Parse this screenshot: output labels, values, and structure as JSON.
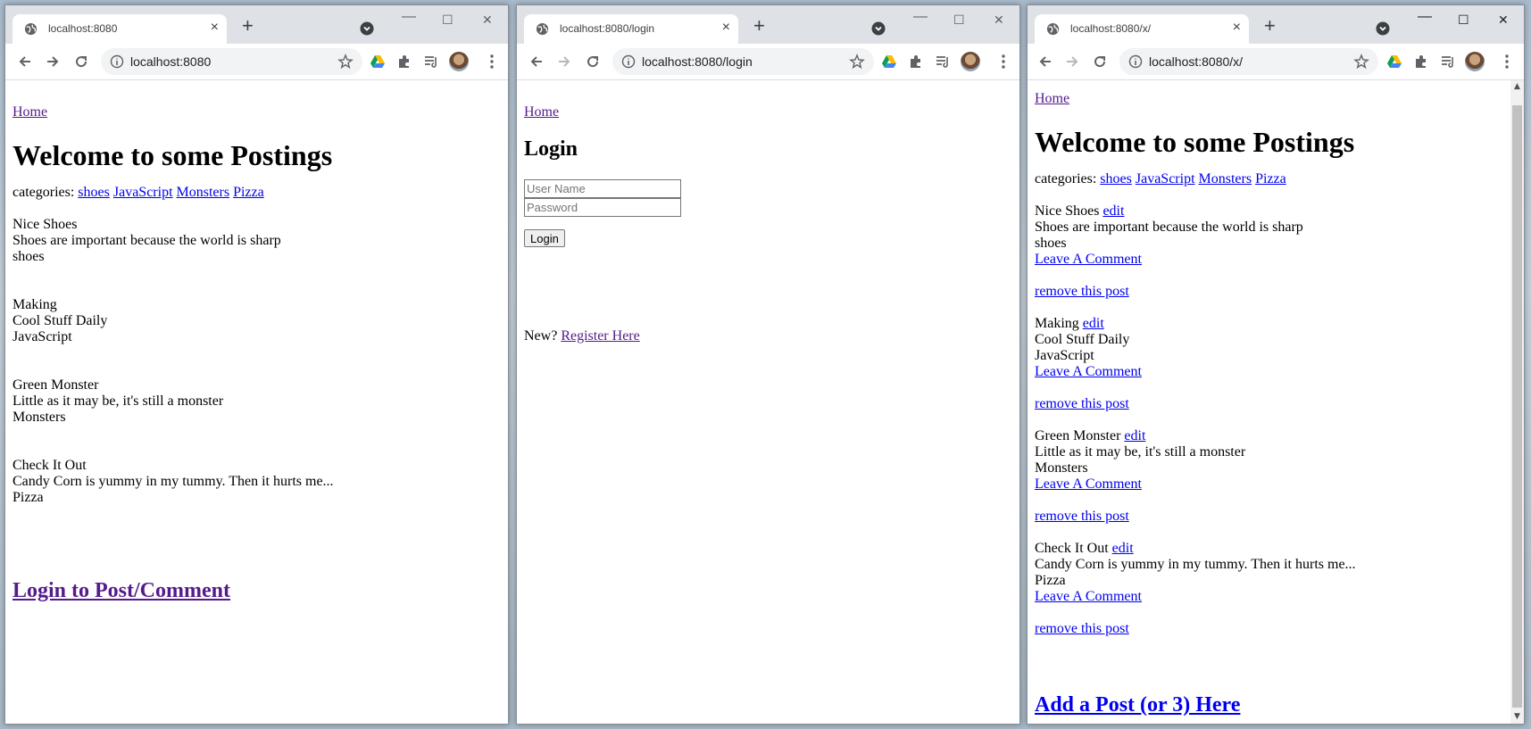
{
  "windows": [
    {
      "tab_title": "localhost:8080",
      "url": "localhost:8080",
      "home_link": "Home",
      "heading": "Welcome to some Postings",
      "categories_label": "categories:",
      "categories": [
        "shoes",
        "JavaScript",
        "Monsters",
        "Pizza"
      ],
      "posts": [
        {
          "title": "Nice Shoes",
          "body": "Shoes are important because the world is sharp",
          "category": "shoes"
        },
        {
          "title": "Making",
          "body": "Cool Stuff Daily",
          "category": "JavaScript"
        },
        {
          "title": "Green Monster",
          "body": "Little as it may be, it's still a monster",
          "category": "Monsters"
        },
        {
          "title": "Check It Out",
          "body": "Candy Corn is yummy in my tummy. Then it hurts me...",
          "category": "Pizza"
        }
      ],
      "footer_link": "Login to Post/Comment"
    },
    {
      "tab_title": "localhost:8080/login",
      "url": "localhost:8080/login",
      "home_link": "Home",
      "heading": "Login",
      "username_placeholder": "User Name",
      "password_placeholder": "Password",
      "login_button": "Login",
      "new_label": "New?",
      "register_link": "Register Here"
    },
    {
      "tab_title": "localhost:8080/x/",
      "url": "localhost:8080/x/",
      "home_link": "Home",
      "heading": "Welcome to some Postings",
      "categories_label": "categories:",
      "categories": [
        "shoes",
        "JavaScript",
        "Monsters",
        "Pizza"
      ],
      "posts": [
        {
          "title": "Nice Shoes",
          "body": "Shoes are important because the world is sharp",
          "category": "shoes"
        },
        {
          "title": "Making",
          "body": "Cool Stuff Daily",
          "category": "JavaScript"
        },
        {
          "title": "Green Monster",
          "body": "Little as it may be, it's still a monster",
          "category": "Monsters"
        },
        {
          "title": "Check It Out",
          "body": "Candy Corn is yummy in my tummy. Then it hurts me...",
          "category": "Pizza"
        }
      ],
      "edit_link": "edit",
      "comment_link": "Leave A Comment",
      "remove_link": "remove this post",
      "footer_link": "Add a Post (or 3) Here"
    }
  ],
  "browser": {
    "new_tab_symbol": "+",
    "close_tab_symbol": "×",
    "minimize_symbol": "—",
    "maximize_symbol": "☐",
    "close_window_symbol": "✕"
  },
  "colors": {
    "link": "#0000ee",
    "visited_link": "#551a8b",
    "tabbar": "#dee1e6",
    "omnibox": "#f1f3f4"
  }
}
